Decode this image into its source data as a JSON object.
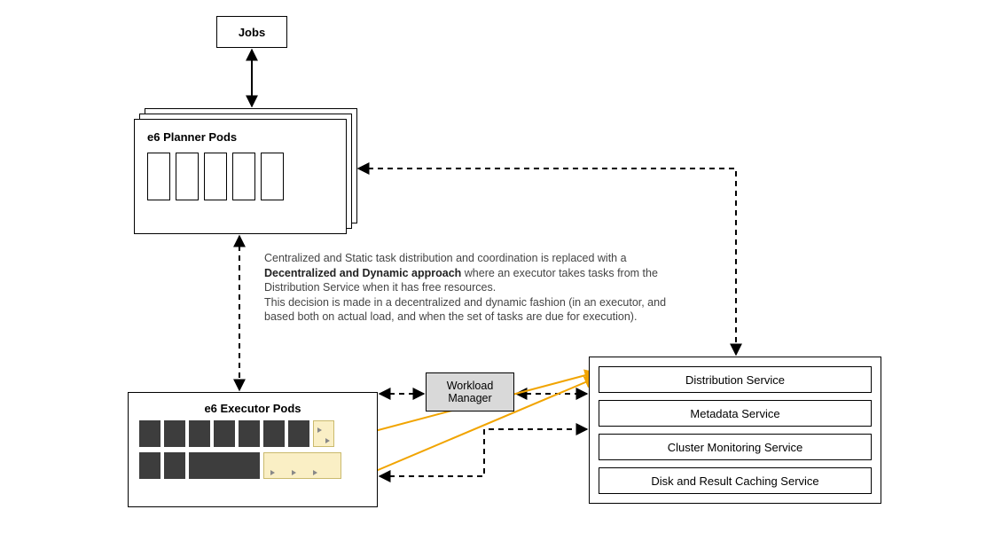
{
  "jobs": {
    "label": "Jobs"
  },
  "planner": {
    "title": "e6 Planner Pods"
  },
  "description": {
    "line1_a": "Centralized and Static task distribution and coordination is replaced with a ",
    "line1_b": "Decentralized and Dynamic approach",
    "line1_c": " where an executor takes tasks from the Distribution Service when it has free resources.",
    "line2": "This decision is made in a decentralized and dynamic fashion (in an executor, and based both on actual load, and when the set of tasks are due for execution)."
  },
  "executor": {
    "title": "e6 Executor Pods"
  },
  "workload": {
    "label": "Workload\nManager"
  },
  "services": {
    "items": [
      "Distribution Service",
      "Metadata Service",
      "Cluster Monitoring Service",
      "Disk and Result Caching Service"
    ]
  }
}
